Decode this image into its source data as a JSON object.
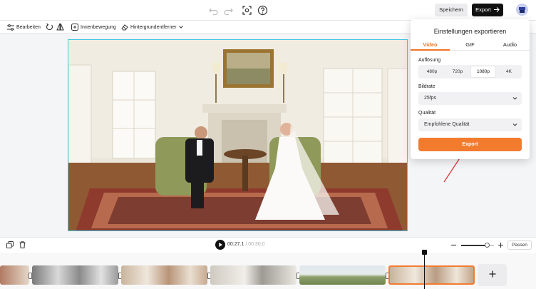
{
  "topbar": {
    "save_label": "Speichern",
    "export_label": "Export",
    "icons": [
      "undo-icon",
      "redo-icon",
      "screenshot-icon",
      "help-icon",
      "arrow-right-icon"
    ]
  },
  "toolbar": {
    "edit_label": "Bearbeiten",
    "motion_label": "Innenbewegung",
    "bg_remover_label": "Hintergrundentferner"
  },
  "playback": {
    "current_time": "00:27.1",
    "duration": "/ 00:30.0",
    "fit_label": "Passen",
    "zoom_level": 0.8
  },
  "export_panel": {
    "title": "Einstellungen exportieren",
    "tabs": [
      {
        "label": "Video",
        "active": true
      },
      {
        "label": "GIF",
        "active": false
      },
      {
        "label": "Audio",
        "active": false
      }
    ],
    "resolution_label": "Auflösung",
    "resolutions": [
      {
        "label": "480p",
        "active": false
      },
      {
        "label": "720p",
        "active": false
      },
      {
        "label": "1080p",
        "active": true
      },
      {
        "label": "4K",
        "active": false
      }
    ],
    "framerate_label": "Bildrate",
    "framerate_value": "25fps",
    "quality_label": "Qualität",
    "quality_value": "Empfohlene Qualität",
    "export_button": "Export"
  },
  "colors": {
    "accent": "#f37b2e",
    "selection": "#41c6e2",
    "annotation_arrow": "#e0343a"
  }
}
